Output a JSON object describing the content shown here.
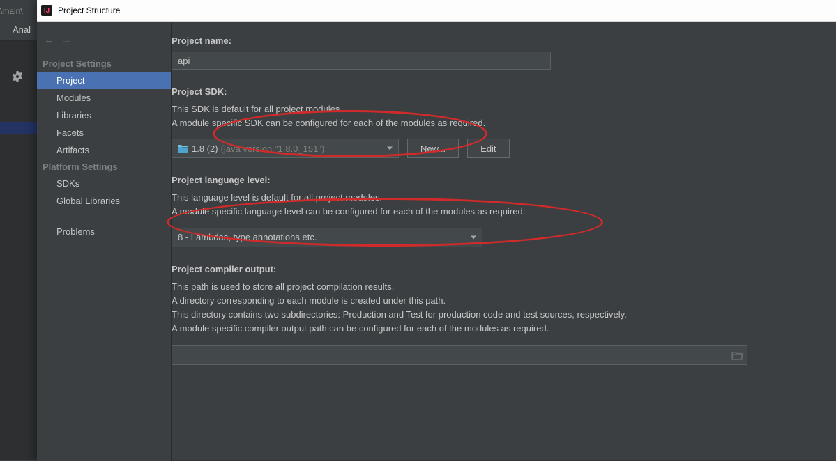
{
  "ide": {
    "path_fragment": "\\main\\",
    "menu_fragment": "Anal"
  },
  "dialog": {
    "title": "Project Structure"
  },
  "sidebar": {
    "heading_project_settings": "Project Settings",
    "heading_platform_settings": "Platform Settings",
    "items_project": "Project",
    "items_modules": "Modules",
    "items_libraries": "Libraries",
    "items_facets": "Facets",
    "items_artifacts": "Artifacts",
    "items_sdks": "SDKs",
    "items_global_libraries": "Global Libraries",
    "items_problems": "Problems"
  },
  "project": {
    "name_label": "Project name:",
    "name_value": "api",
    "sdk_label": "Project SDK:",
    "sdk_desc1": "This SDK is default for all project modules.",
    "sdk_desc2": "A module specific SDK can be configured for each of the modules as required.",
    "sdk_selected": "1.8 (2)",
    "sdk_selected_version": "(java version \"1.8.0_151\")",
    "btn_new_pre": "N",
    "btn_new_post": "ew...",
    "btn_edit_pre": "E",
    "btn_edit_post": "dit",
    "lang_label": "Project language level:",
    "lang_desc1": "This language level is default for all project modules.",
    "lang_desc2": "A module specific language level can be configured for each of the modules as required.",
    "lang_selected": "8 - Lambdas, type annotations etc.",
    "out_label": "Project compiler output:",
    "out_desc1": "This path is used to store all project compilation results.",
    "out_desc2": "A directory corresponding to each module is created under this path.",
    "out_desc3": "This directory contains two subdirectories: Production and Test for production code and test sources, respectively.",
    "out_desc4": "A module specific compiler output path can be configured for each of the modules as required.",
    "out_value": ""
  }
}
